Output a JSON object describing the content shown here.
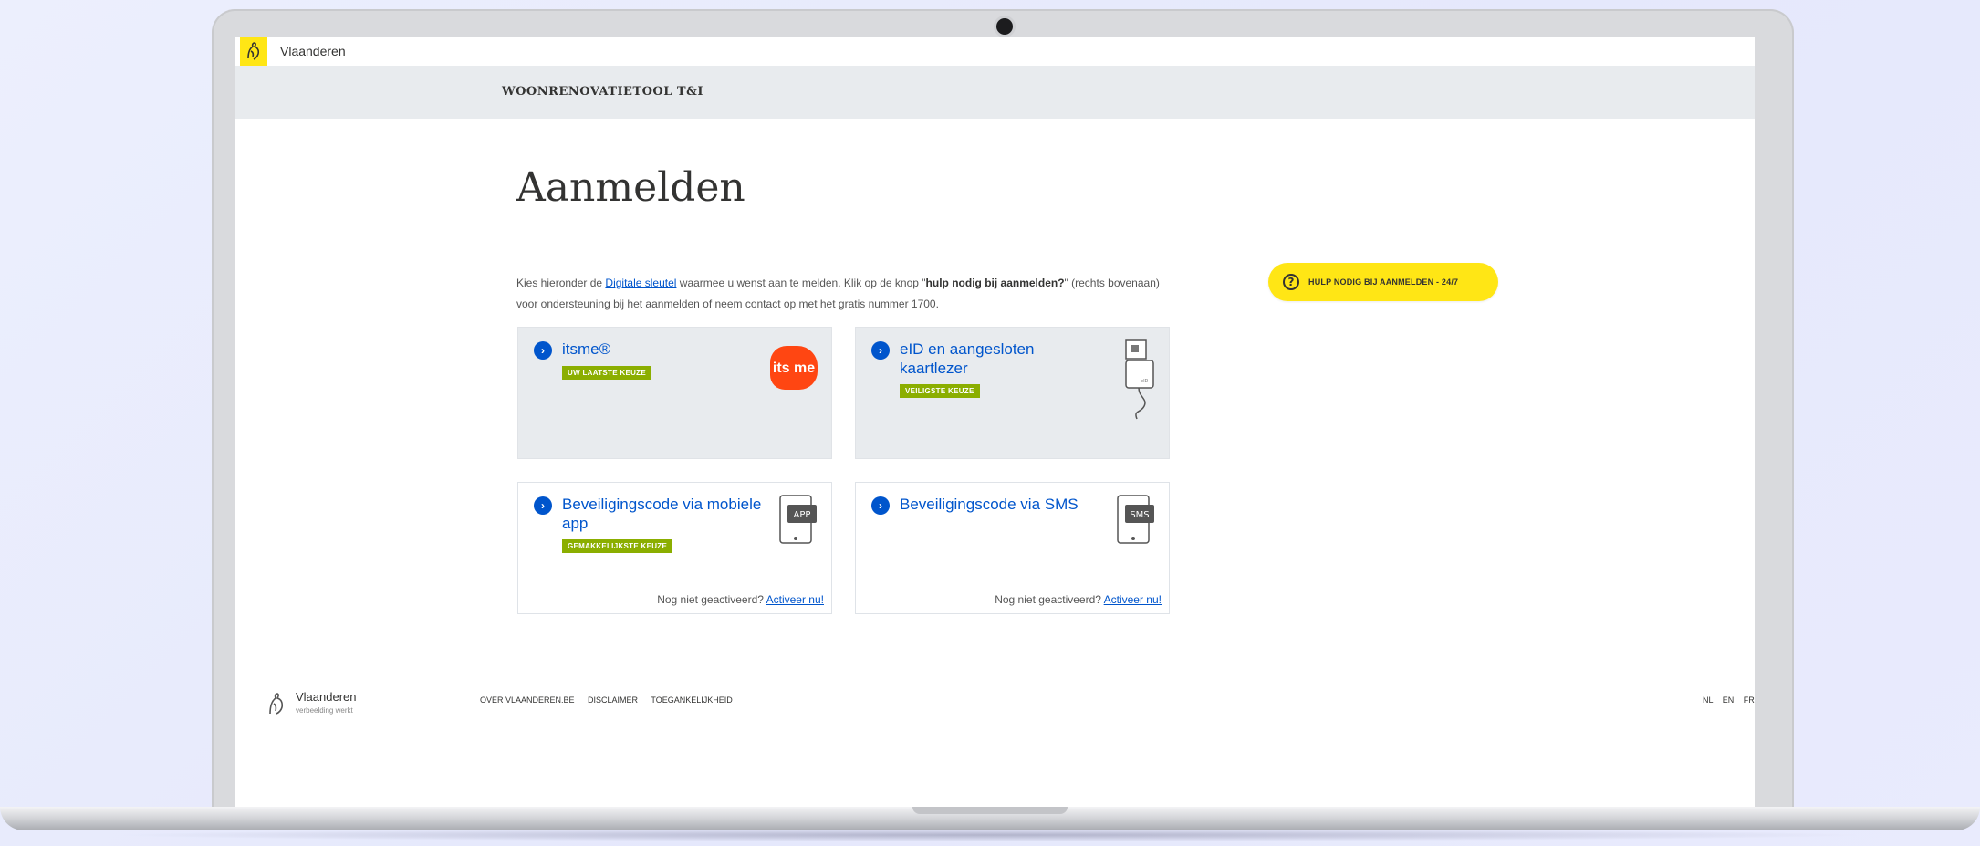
{
  "header": {
    "brand": "Vlaanderen",
    "app_title": "WOONRENOVATIETOOL T&I"
  },
  "main": {
    "title": "Aanmelden",
    "intro": {
      "p1": "Kies hieronder de ",
      "link": "Digitale sleutel",
      "p2": " waarmee u wenst aan te melden. Klik op de knop \"",
      "bold": "hulp nodig bij aanmelden?",
      "p3": "\" (rechts bovenaan) voor ondersteuning bij het aanmelden of neem contact op met het gratis nummer 1700."
    },
    "help_button": "HULP NODIG BIJ AANMELDEN - 24/7",
    "tiles": [
      {
        "name": "itsme®",
        "badge": "UW LAATSTE KEUZE",
        "icon": "itsme-logo-icon",
        "logo_text": "its me"
      },
      {
        "name": "eID en aangesloten kaartlezer",
        "badge": "VEILIGSTE KEUZE",
        "icon": "card-reader-icon"
      },
      {
        "name": "Beveiligingscode via mobiele app",
        "badge": "GEMAKKELIJKSTE KEUZE",
        "icon": "phone-app-icon",
        "icon_label": "APP",
        "footer_text": "Nog niet geactiveerd? ",
        "footer_link": "Activeer nu!"
      },
      {
        "name": "Beveiligingscode via SMS",
        "icon": "phone-sms-icon",
        "icon_label": "SMS",
        "footer_text": "Nog niet geactiveerd? ",
        "footer_link": "Activeer nu!"
      }
    ]
  },
  "footer": {
    "brand": "Vlaanderen",
    "tagline": "verbeelding werkt",
    "links": [
      "OVER VLAANDEREN.BE",
      "DISCLAIMER",
      "TOEGANKELIJKHEID"
    ],
    "languages": [
      "NL",
      "EN",
      "FR"
    ]
  },
  "colors": {
    "accent_yellow": "#ffe615",
    "link_blue": "#0055cc",
    "badge_green": "#8bae00",
    "itsme_orange": "#ff4612"
  }
}
